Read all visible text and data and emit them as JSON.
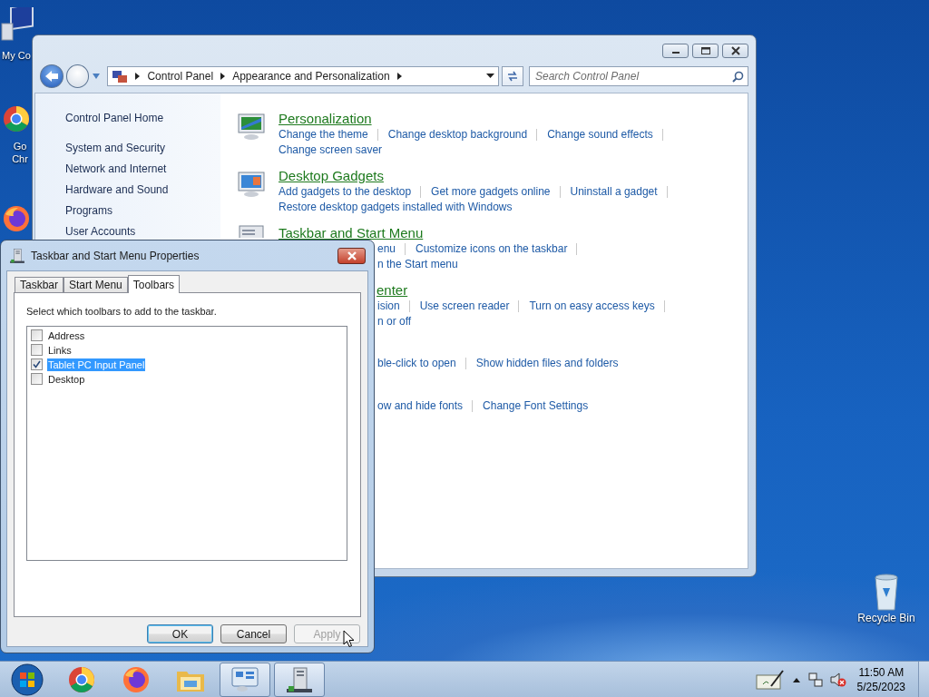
{
  "desktop_icons": [
    {
      "kind": "computer",
      "label": "My Co"
    },
    {
      "kind": "chrome",
      "label": "Go Chr"
    },
    {
      "kind": "firefox"
    },
    {
      "kind": "recycle",
      "label": "Recycle Bin"
    }
  ],
  "control_panel": {
    "breadcrumb": [
      "Control Panel",
      "Appearance and Personalization"
    ],
    "search": {
      "placeholder": "Search Control Panel"
    },
    "nav": [
      {
        "kind": "home",
        "label": "Control Panel Home"
      },
      {
        "kind": "category",
        "label": "System and Security"
      },
      {
        "kind": "category",
        "label": "Network and Internet"
      },
      {
        "kind": "category",
        "label": "Hardware and Sound"
      },
      {
        "kind": "category",
        "label": "Programs"
      },
      {
        "kind": "category",
        "label": "User Accounts"
      }
    ],
    "categories": [
      {
        "title": "Personalization",
        "title_cut": false,
        "lines": [
          {
            "cut": false,
            "links": [
              "Change the theme",
              "Change desktop background",
              "Change sound effects"
            ]
          },
          {
            "cut": false,
            "links": [
              "Change screen saver"
            ]
          }
        ]
      },
      {
        "title": "Desktop Gadgets",
        "title_cut": false,
        "lines": [
          {
            "cut": false,
            "links": [
              "Add gadgets to the desktop",
              "Get more gadgets online",
              "Uninstall a gadget"
            ]
          },
          {
            "cut": false,
            "links": [
              "Restore desktop gadgets installed with Windows"
            ]
          }
        ]
      },
      {
        "title": "Taskbar and Start Menu",
        "title_cut": false,
        "lines": [
          {
            "cut": true,
            "links": [
              "enu",
              "Customize icons on the taskbar"
            ]
          },
          {
            "cut": true,
            "links": [
              "n the Start menu"
            ]
          }
        ]
      },
      {
        "title": "enter",
        "title_cut": true,
        "lines": [
          {
            "cut": true,
            "links": [
              "ision",
              "Use screen reader",
              "Turn on easy access keys"
            ]
          },
          {
            "cut": true,
            "links": [
              "n or off"
            ]
          }
        ]
      },
      {
        "lines": [
          {
            "cut": true,
            "links": [
              "ble-click to open",
              "Show hidden files and folders"
            ]
          }
        ]
      },
      {
        "lines": [
          {
            "cut": true,
            "links": [
              "ow and hide fonts",
              "Change Font Settings"
            ]
          }
        ]
      }
    ]
  },
  "dialog": {
    "title": "Taskbar and Start Menu Properties",
    "tabs": [
      {
        "label": "Taskbar",
        "selected": false
      },
      {
        "label": "Start Menu",
        "selected": false
      },
      {
        "label": "Toolbars",
        "selected": true
      }
    ],
    "instruction": "Select which toolbars to add to the taskbar.",
    "toolbars": [
      {
        "label": "Address",
        "checked": false,
        "selected": false
      },
      {
        "label": "Links",
        "checked": false,
        "selected": false
      },
      {
        "label": "Tablet PC Input Panel",
        "checked": true,
        "selected": true
      },
      {
        "label": "Desktop",
        "checked": false,
        "selected": false
      }
    ],
    "buttons": [
      {
        "label": "OK",
        "default": true,
        "disabled": false
      },
      {
        "label": "Cancel",
        "default": false,
        "disabled": false
      },
      {
        "label": "Apply",
        "default": false,
        "disabled": true
      }
    ]
  },
  "taskbar": {
    "items": [
      {
        "kind": "chrome",
        "open": false
      },
      {
        "kind": "firefox",
        "open": false
      },
      {
        "kind": "explorer",
        "open": false
      },
      {
        "kind": "controlpanel",
        "open": true
      },
      {
        "kind": "properties",
        "open": true
      }
    ],
    "clock": {
      "time": "11:50 AM",
      "date": "5/25/2023"
    }
  }
}
